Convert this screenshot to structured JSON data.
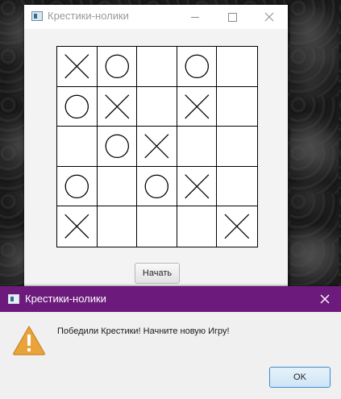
{
  "window": {
    "title": "Крестики-нолики",
    "start_button_label": "Начать"
  },
  "board": {
    "rows": 5,
    "cols": 5,
    "cells": [
      [
        "X",
        "O",
        "",
        "O",
        ""
      ],
      [
        "O",
        "X",
        "",
        "X",
        ""
      ],
      [
        "",
        "O",
        "X",
        "",
        ""
      ],
      [
        "O",
        "",
        "O",
        "X",
        ""
      ],
      [
        "X",
        "",
        "",
        "",
        "X"
      ]
    ]
  },
  "dialog": {
    "title": "Крестики-нолики",
    "message": "Победили Крестики! Начните новую Игру!",
    "ok_label": "OK",
    "icon": "warning-icon"
  },
  "colors": {
    "dialog_titlebar": "#6c1a7b",
    "ok_border": "#3c8bc9",
    "warning": "#e8a33a"
  }
}
